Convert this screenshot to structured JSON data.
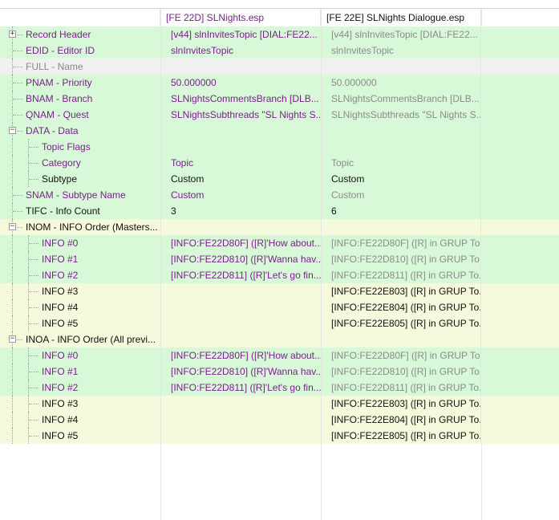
{
  "colors": {
    "green": "#d8f9d8",
    "yellow": "#f4fadb",
    "grey_row": "#f0f0f0",
    "purple_text": "#7a1f8c",
    "grey_text": "#8a8a8a"
  },
  "header": {
    "col1": "[FE 22D] SLNights.esp",
    "col2": "[FE 22E] SLNights Dialogue.esp"
  },
  "rows": [
    {
      "label": "Record Header",
      "level": 1,
      "expander": "plus",
      "bg": "green",
      "v1": "[v44] slnInvitesTopic [DIAL:FE22...",
      "v2": "[v44] slnInvitesTopic [DIAL:FE22...",
      "c0": "purple",
      "c1": "purple",
      "c2": "grey"
    },
    {
      "label": "EDID - Editor ID",
      "level": 1,
      "bg": "green",
      "v1": "slnInvitesTopic",
      "v2": "slnInvitesTopic",
      "c0": "purple",
      "c1": "purple",
      "c2": "grey"
    },
    {
      "label": "FULL - Name",
      "level": 1,
      "bg": "grey_row",
      "v1": "",
      "v2": "",
      "c0": "grey",
      "c1": "grey",
      "c2": "grey"
    },
    {
      "label": "PNAM - Priority",
      "level": 1,
      "bg": "green",
      "v1": "50.000000",
      "v2": "50.000000",
      "c0": "purple",
      "c1": "purple",
      "c2": "grey"
    },
    {
      "label": "BNAM - Branch",
      "level": 1,
      "bg": "green",
      "v1": "SLNightsCommentsBranch [DLB...",
      "v2": "SLNightsCommentsBranch [DLB...",
      "c0": "purple",
      "c1": "purple",
      "c2": "grey"
    },
    {
      "label": "QNAM - Quest",
      "level": 1,
      "bg": "green",
      "v1": "SLNightsSubthreads \"SL Nights S...",
      "v2": "SLNightsSubthreads \"SL Nights S...",
      "c0": "purple",
      "c1": "purple",
      "c2": "grey"
    },
    {
      "label": "DATA - Data",
      "level": 1,
      "expander": "minus",
      "bg": "green",
      "v1": "",
      "v2": "",
      "c0": "purple",
      "c1": "purple",
      "c2": "grey"
    },
    {
      "label": "Topic Flags",
      "level": 2,
      "bg": "green",
      "v1": "",
      "v2": "",
      "c0": "purple",
      "c1": "purple",
      "c2": "grey"
    },
    {
      "label": "Category",
      "level": 2,
      "bg": "green",
      "v1": "Topic",
      "v2": "Topic",
      "c0": "purple",
      "c1": "purple",
      "c2": "grey"
    },
    {
      "label": "Subtype",
      "level": 2,
      "bg": "green",
      "v1": "Custom",
      "v2": "Custom",
      "c0": "black",
      "c1": "black",
      "c2": "black"
    },
    {
      "label": "SNAM - Subtype Name",
      "level": 1,
      "bg": "green",
      "v1": "Custom",
      "v2": "Custom",
      "c0": "purple",
      "c1": "purple",
      "c2": "grey"
    },
    {
      "label": "TIFC - Info Count",
      "level": 1,
      "bg": "green",
      "v1": "3",
      "v2": "6",
      "c0": "black",
      "c1": "black",
      "c2": "black"
    },
    {
      "label": "INOM - INFO Order (Masters...",
      "level": 1,
      "expander": "minus",
      "bg": "yellow",
      "v1": "",
      "v2": "",
      "c0": "black",
      "c1": "black",
      "c2": "black"
    },
    {
      "label": "INFO #0",
      "level": 2,
      "bg": "green",
      "v1": "[INFO:FE22D80F] ([R]'How about...",
      "v2": "[INFO:FE22D80F] ([R] in GRUP To...",
      "c0": "purple",
      "c1": "purple",
      "c2": "grey"
    },
    {
      "label": "INFO #1",
      "level": 2,
      "bg": "green",
      "v1": "[INFO:FE22D810] ([R]'Wanna hav...",
      "v2": "[INFO:FE22D810] ([R] in GRUP To...",
      "c0": "purple",
      "c1": "purple",
      "c2": "grey"
    },
    {
      "label": "INFO #2",
      "level": 2,
      "bg": "green",
      "v1": "[INFO:FE22D811] ([R]'Let's go fin...",
      "v2": "[INFO:FE22D811] ([R] in GRUP To...",
      "c0": "purple",
      "c1": "purple",
      "c2": "grey"
    },
    {
      "label": "INFO #3",
      "level": 2,
      "bg": "yellow",
      "v1": "",
      "v2": "[INFO:FE22E803] ([R] in GRUP To...",
      "c0": "black",
      "c1": "black",
      "c2": "black"
    },
    {
      "label": "INFO #4",
      "level": 2,
      "bg": "yellow",
      "v1": "",
      "v2": "[INFO:FE22E804] ([R] in GRUP To...",
      "c0": "black",
      "c1": "black",
      "c2": "black"
    },
    {
      "label": "INFO #5",
      "level": 2,
      "bg": "yellow",
      "v1": "",
      "v2": "[INFO:FE22E805] ([R] in GRUP To...",
      "c0": "black",
      "c1": "black",
      "c2": "black"
    },
    {
      "label": "INOA - INFO Order (All previ...",
      "level": 1,
      "expander": "minus",
      "bg": "yellow",
      "v1": "",
      "v2": "",
      "c0": "black",
      "c1": "black",
      "c2": "black"
    },
    {
      "label": "INFO #0",
      "level": 2,
      "bg": "green",
      "v1": "[INFO:FE22D80F] ([R]'How about...",
      "v2": "[INFO:FE22D80F] ([R] in GRUP To...",
      "c0": "purple",
      "c1": "purple",
      "c2": "grey"
    },
    {
      "label": "INFO #1",
      "level": 2,
      "bg": "green",
      "v1": "[INFO:FE22D810] ([R]'Wanna hav...",
      "v2": "[INFO:FE22D810] ([R] in GRUP To...",
      "c0": "purple",
      "c1": "purple",
      "c2": "grey"
    },
    {
      "label": "INFO #2",
      "level": 2,
      "bg": "green",
      "v1": "[INFO:FE22D811] ([R]'Let's go fin...",
      "v2": "[INFO:FE22D811] ([R] in GRUP To...",
      "c0": "purple",
      "c1": "purple",
      "c2": "grey"
    },
    {
      "label": "INFO #3",
      "level": 2,
      "bg": "yellow",
      "v1": "",
      "v2": "[INFO:FE22E803] ([R] in GRUP To...",
      "c0": "black",
      "c1": "black",
      "c2": "black"
    },
    {
      "label": "INFO #4",
      "level": 2,
      "bg": "yellow",
      "v1": "",
      "v2": "[INFO:FE22E804] ([R] in GRUP To...",
      "c0": "black",
      "c1": "black",
      "c2": "black"
    },
    {
      "label": "INFO #5",
      "level": 2,
      "bg": "yellow",
      "v1": "",
      "v2": "[INFO:FE22E805] ([R] in GRUP To...",
      "c0": "black",
      "c1": "black",
      "c2": "black"
    }
  ]
}
